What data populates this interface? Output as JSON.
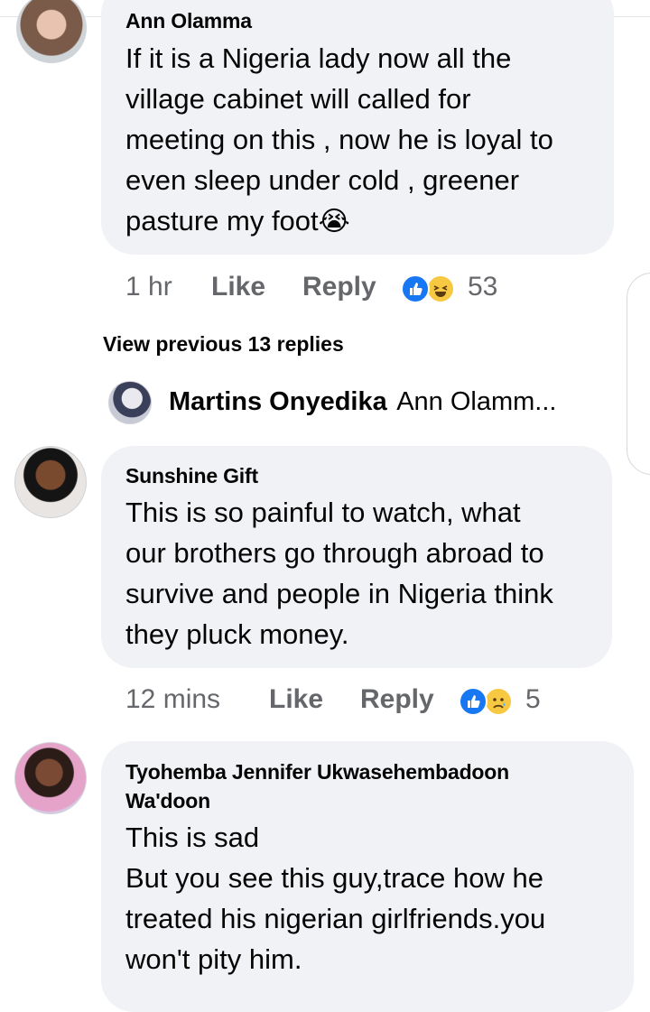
{
  "comments": [
    {
      "author": "Ann Olamma",
      "lines": [
        "If it is a  Nigeria lady now all the",
        "village cabinet will called for",
        "meeting on this , now he is loyal to",
        "even sleep under cold , greener",
        "pasture my foot"
      ],
      "emoji": "😭",
      "time": "1 hr",
      "like_label": "Like",
      "reply_label": "Reply",
      "reaction_count": "53"
    },
    {
      "author": "Sunshine Gift",
      "lines": [
        "This is so painful to watch, what",
        "our brothers go through abroad to",
        "survive and people in Nigeria think",
        "they pluck money."
      ],
      "time": "12 mins",
      "like_label": "Like",
      "reply_label": "Reply",
      "reaction_count": "5"
    },
    {
      "author_line1": "Tyohemba Jennifer Ukwasehembadoon",
      "author_line2": "Wa'doon",
      "lines": [
        "This is sad",
        "But you see this guy,trace how he",
        "treated his nigerian girlfriends.you",
        "won't pity him."
      ]
    }
  ],
  "thread": {
    "view_previous": "View previous 13 replies",
    "reply_author": "Martins Onyedika",
    "reply_preview": "Ann Olamm..."
  },
  "colors": {
    "bubble": "#f0f2f5",
    "meta": "#65676b",
    "like_blue": "#1877f2"
  }
}
